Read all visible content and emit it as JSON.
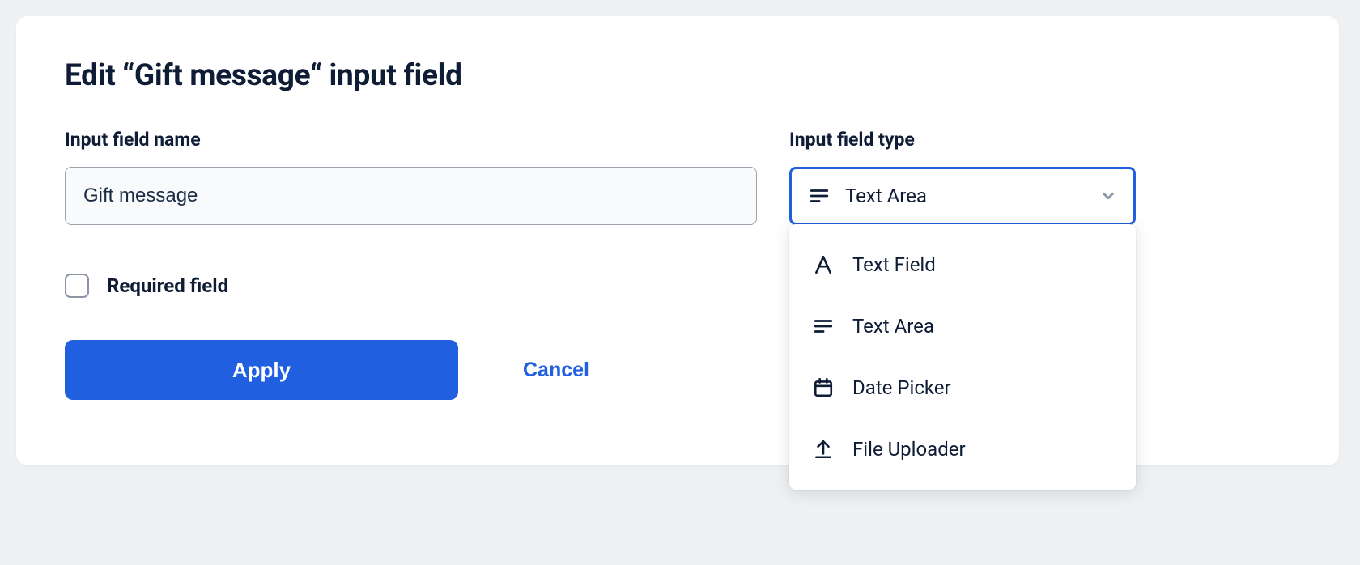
{
  "header": {
    "title": "Edit “Gift message“ input field"
  },
  "fields": {
    "name_label": "Input field name",
    "name_value": "Gift message",
    "type_label": "Input field type",
    "type_selected": "Text Area",
    "type_options": [
      {
        "icon": "letter-a-icon",
        "label": "Text Field"
      },
      {
        "icon": "textarea-icon",
        "label": "Text Area"
      },
      {
        "icon": "calendar-icon",
        "label": "Date Picker"
      },
      {
        "icon": "upload-icon",
        "label": "File Uploader"
      }
    ]
  },
  "checkbox": {
    "required_label": "Required field"
  },
  "buttons": {
    "apply": "Apply",
    "cancel": "Cancel"
  }
}
